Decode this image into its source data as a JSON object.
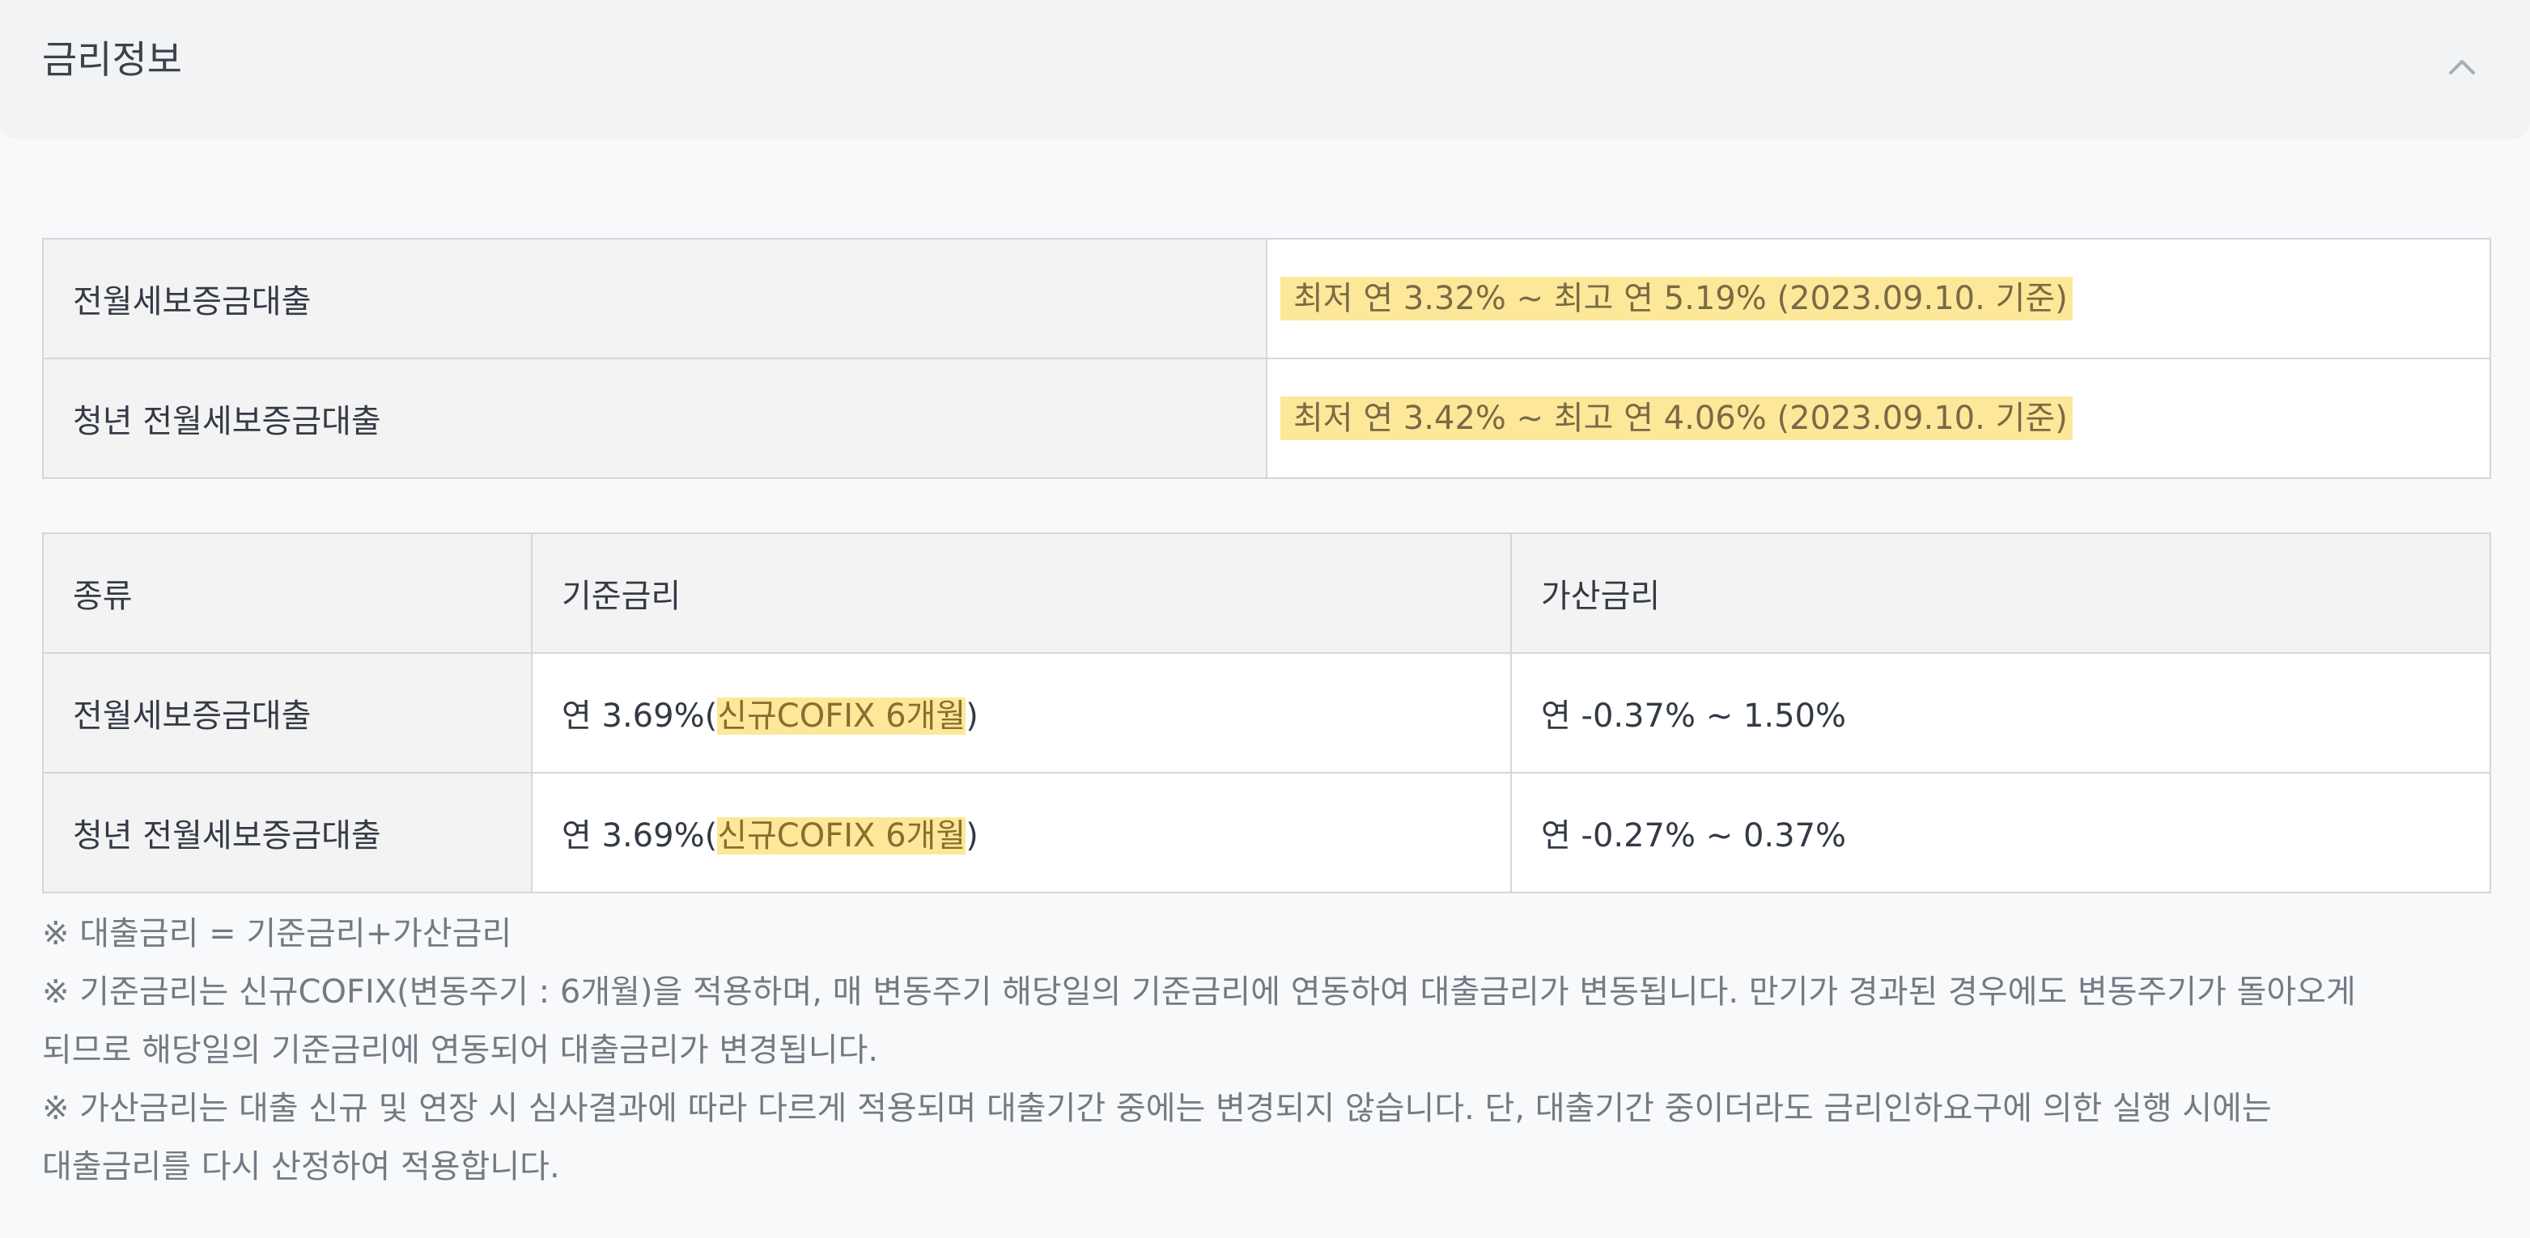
{
  "section": {
    "title": "금리정보",
    "collapse_icon": "chevron-up-icon"
  },
  "rate_summary": {
    "rows": [
      {
        "product": "전월세보증금대출",
        "range": "최저 연 3.32% ~ 최고 연 5.19% (2023.09.10. 기준)"
      },
      {
        "product": "청년 전월세보증금대출",
        "range": "최저 연 3.42% ~ 최고 연 4.06% (2023.09.10. 기준)"
      }
    ]
  },
  "rate_detail": {
    "headers": [
      "종류",
      "기준금리",
      "가산금리"
    ],
    "rows": [
      {
        "product": "전월세보증금대출",
        "base_prefix": "연 3.69%(",
        "base_highlight": "신규COFIX 6개월",
        "base_suffix": ")",
        "spread": "연 -0.37% ~ 1.50%"
      },
      {
        "product": "청년 전월세보증금대출",
        "base_prefix": "연 3.69%(",
        "base_highlight": "신규COFIX 6개월",
        "base_suffix": ")",
        "spread": "연 -0.27% ~ 0.37%"
      }
    ]
  },
  "notes": [
    "※ 대출금리 = 기준금리+가산금리",
    "※ 기준금리는 신규COFIX(변동주기 : 6개월)을 적용하며, 매 변동주기 해당일의 기준금리에 연동하여 대출금리가 변동됩니다. 만기가 경과된 경우에도 변동주기가 돌아오게",
    "되므로 해당일의 기준금리에 연동되어 대출금리가 변경됩니다.",
    "※ 가산금리는 대출 신규 및 연장 시 심사결과에 따라 다르게 적용되며 대출기간 중에는 변경되지 않습니다. 단, 대출기간 중이더라도 금리인하요구에 의한 실행 시에는",
    "대출금리를 다시 산정하여 적용합니다."
  ],
  "colors": {
    "highlight": "#fde89a",
    "header_bg": "#f2f3f5",
    "table_border": "#d4d6da"
  }
}
